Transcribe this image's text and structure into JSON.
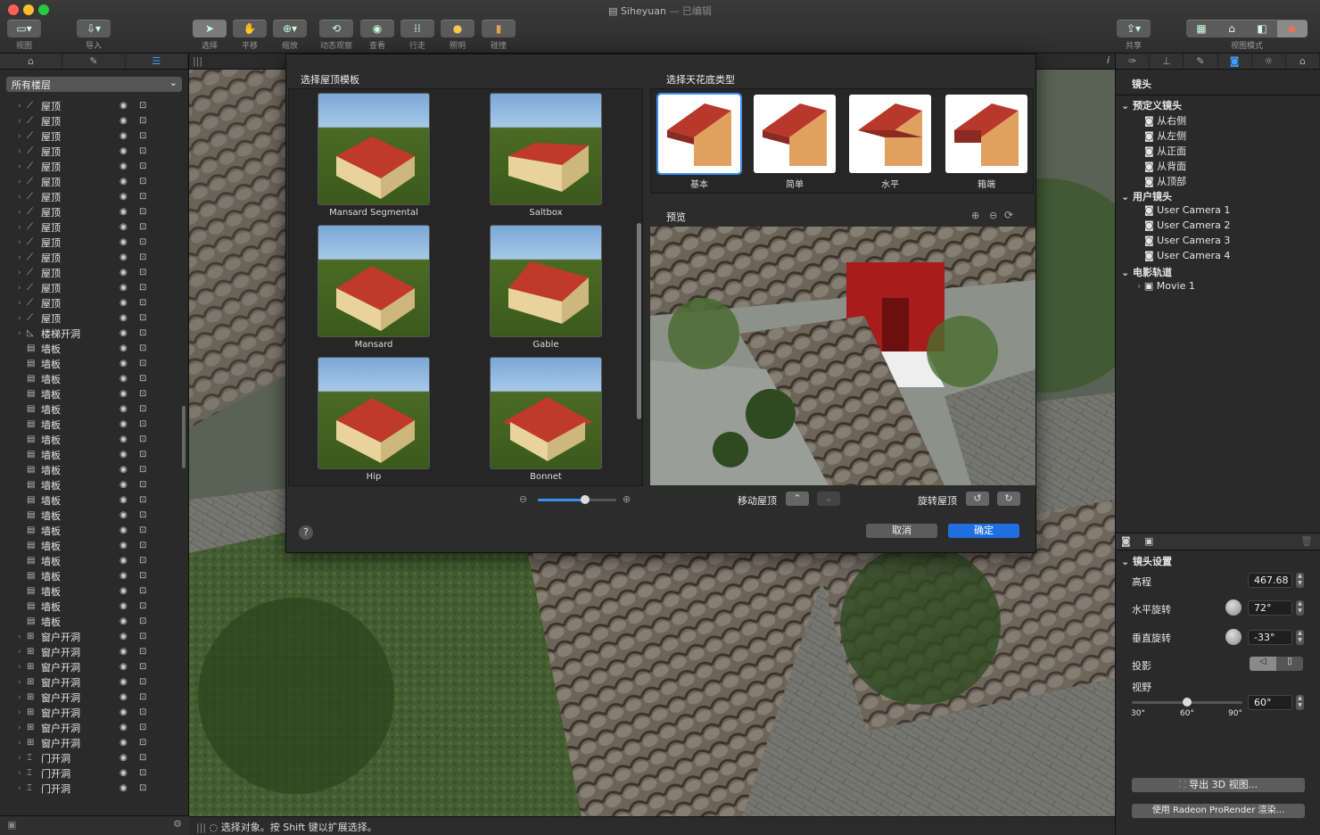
{
  "window": {
    "title": "Siheyuan",
    "edited": "— 已编辑"
  },
  "toolbar": {
    "view": "视图",
    "import": "导入",
    "select": "选择",
    "pan": "平移",
    "zoom": "缩放",
    "orbit": "动态观察",
    "look": "查看",
    "walk": "行走",
    "light": "照明",
    "collide": "碰撞",
    "share": "共享",
    "view_mode": "视图模式"
  },
  "left": {
    "floor_select": "所有楼层",
    "rows": [
      {
        "name": "屋顶",
        "type": "roof"
      },
      {
        "name": "屋顶",
        "type": "roof"
      },
      {
        "name": "屋顶",
        "type": "roof"
      },
      {
        "name": "屋顶",
        "type": "roof"
      },
      {
        "name": "屋顶",
        "type": "roof"
      },
      {
        "name": "屋顶",
        "type": "roof"
      },
      {
        "name": "屋顶",
        "type": "roof"
      },
      {
        "name": "屋顶",
        "type": "roof"
      },
      {
        "name": "屋顶",
        "type": "roof"
      },
      {
        "name": "屋顶",
        "type": "roof"
      },
      {
        "name": "屋顶",
        "type": "roof"
      },
      {
        "name": "屋顶",
        "type": "roof"
      },
      {
        "name": "屋顶",
        "type": "roof"
      },
      {
        "name": "屋顶",
        "type": "roof"
      },
      {
        "name": "屋顶",
        "type": "roof"
      },
      {
        "name": "楼梯开洞",
        "type": "stair"
      },
      {
        "name": "墙板",
        "type": "slab"
      },
      {
        "name": "墙板",
        "type": "slab"
      },
      {
        "name": "墙板",
        "type": "slab"
      },
      {
        "name": "墙板",
        "type": "slab"
      },
      {
        "name": "墙板",
        "type": "slab"
      },
      {
        "name": "墙板",
        "type": "slab"
      },
      {
        "name": "墙板",
        "type": "slab"
      },
      {
        "name": "墙板",
        "type": "slab"
      },
      {
        "name": "墙板",
        "type": "slab"
      },
      {
        "name": "墙板",
        "type": "slab"
      },
      {
        "name": "墙板",
        "type": "slab"
      },
      {
        "name": "墙板",
        "type": "slab"
      },
      {
        "name": "墙板",
        "type": "slab"
      },
      {
        "name": "墙板",
        "type": "slab"
      },
      {
        "name": "墙板",
        "type": "slab"
      },
      {
        "name": "墙板",
        "type": "slab"
      },
      {
        "name": "墙板",
        "type": "slab"
      },
      {
        "name": "墙板",
        "type": "slab"
      },
      {
        "name": "墙板",
        "type": "slab"
      },
      {
        "name": "窗户开洞",
        "type": "window"
      },
      {
        "name": "窗户开洞",
        "type": "window"
      },
      {
        "name": "窗户开洞",
        "type": "window"
      },
      {
        "name": "窗户开洞",
        "type": "window"
      },
      {
        "name": "窗户开洞",
        "type": "window"
      },
      {
        "name": "窗户开洞",
        "type": "window"
      },
      {
        "name": "窗户开洞",
        "type": "window"
      },
      {
        "name": "窗户开洞",
        "type": "window"
      },
      {
        "name": "门开洞",
        "type": "door"
      },
      {
        "name": "门开洞",
        "type": "door"
      },
      {
        "name": "门开洞",
        "type": "door"
      }
    ]
  },
  "dialog": {
    "template_heading": "选择屋顶模板",
    "ceiling_heading": "选择天花底类型",
    "preview_label": "预览",
    "templates": [
      "Mansard Segmental",
      "Saltbox",
      "Mansard",
      "Gable",
      "Hip",
      "Bonnet"
    ],
    "ceiling_types": [
      "基本",
      "简单",
      "水平",
      "箱端"
    ],
    "selected_ceiling": "基本",
    "move_roof": "移动屋顶",
    "rotate_roof": "旋转屋顶",
    "cancel": "取消",
    "ok": "确定",
    "help": "?",
    "zoom_level": 0.6
  },
  "right": {
    "camera_title": "镜头",
    "predefined": "预定义镜头",
    "predef_items": [
      "从右侧",
      "从左侧",
      "从正面",
      "从背面",
      "从顶部"
    ],
    "user_cameras": "用户镜头",
    "user_items": [
      "User Camera 1",
      "User Camera 2",
      "User Camera 3",
      "User Camera 4"
    ],
    "movie_track": "电影轨道",
    "movie_items": [
      "Movie 1"
    ],
    "settings_title": "镜头设置",
    "elevation_label": "高程",
    "elevation": "467.68",
    "hrot_label": "水平旋转",
    "hrot": "72°",
    "vrot_label": "垂直旋转",
    "vrot": "-33°",
    "projection_label": "投影",
    "fov_label": "视野",
    "fov": "60°",
    "fov_ticks": [
      "30°",
      "60°",
      "90°"
    ],
    "fov_slider": 0.5,
    "export_btn": "导出 3D 视图...",
    "render_btn": "使用 Radeon ProRender 渲染..."
  },
  "status": {
    "text": "选择对象。按 Shift 键以扩展选择。"
  },
  "colors": {
    "accent": "#3b8ff0",
    "roof_red": "#b8382c",
    "grass": "#3d5c1e"
  }
}
